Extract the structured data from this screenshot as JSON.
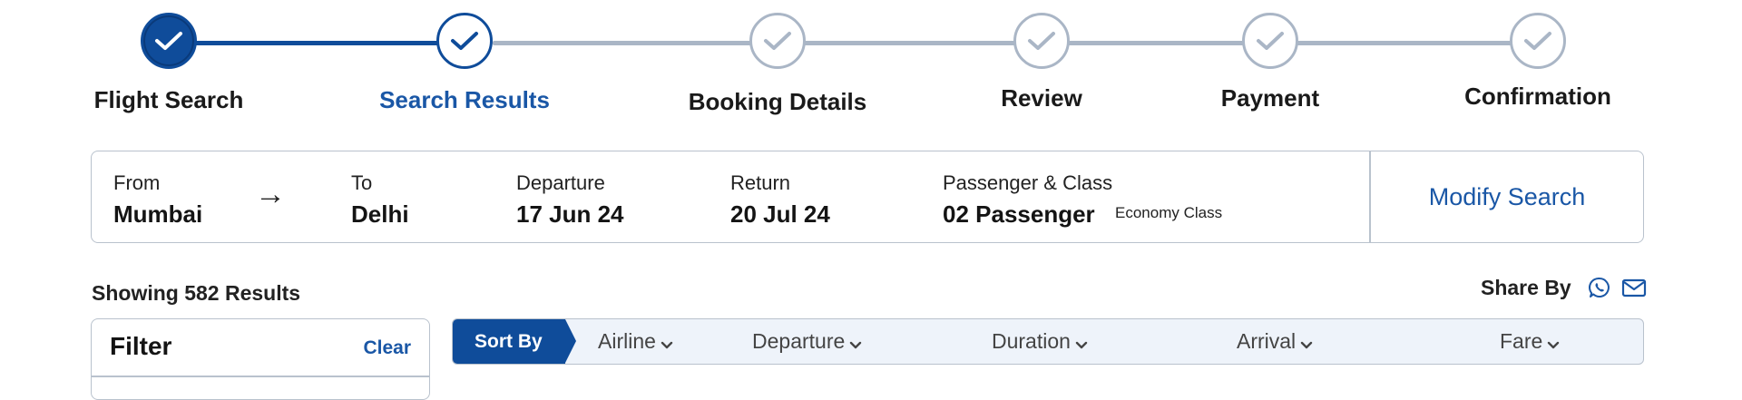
{
  "stepper": {
    "steps": [
      {
        "label": "Flight Search",
        "state": "done"
      },
      {
        "label": "Search Results",
        "state": "current"
      },
      {
        "label": "Booking Details",
        "state": "todo"
      },
      {
        "label": "Review",
        "state": "todo"
      },
      {
        "label": "Payment",
        "state": "todo"
      },
      {
        "label": "Confirmation",
        "state": "todo"
      }
    ]
  },
  "search": {
    "from_label": "From",
    "from_value": "Mumbai",
    "to_label": "To",
    "to_value": "Delhi",
    "departure_label": "Departure",
    "departure_value": "17 Jun 24",
    "return_label": "Return",
    "return_value": "20 Jul 24",
    "passenger_label": "Passenger & Class",
    "passenger_value": "02 Passenger",
    "class_value": "Economy Class",
    "modify_label": "Modify Search"
  },
  "results": {
    "count_text": "Showing 582 Results",
    "share_label": "Share By"
  },
  "filter": {
    "title": "Filter",
    "clear_label": "Clear"
  },
  "sort": {
    "sort_by_label": "Sort By",
    "options": [
      "Airline",
      "Departure",
      "Duration",
      "Arrival",
      "Fare"
    ]
  },
  "colors": {
    "primary": "#0f4c9a",
    "link": "#1a57a6",
    "inactive": "#aab6c6",
    "sort_bg": "#eef3fa"
  },
  "icons": {
    "share": [
      "whatsapp-icon",
      "mail-icon"
    ]
  }
}
